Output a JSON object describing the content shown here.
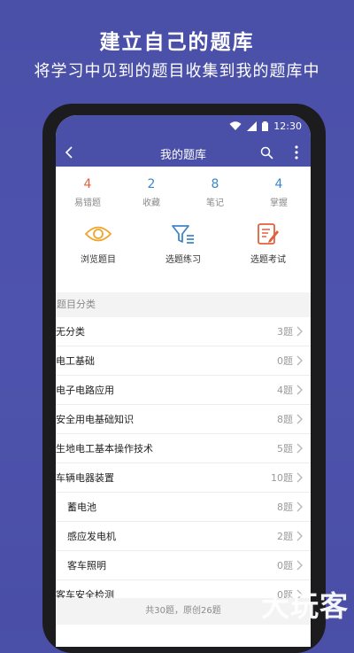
{
  "promo": {
    "title": "建立自己的题库",
    "subtitle": "将学习中见到的题目收集到我的题库中"
  },
  "status_bar": {
    "time": "12:30"
  },
  "app_bar": {
    "title": "我的题库"
  },
  "stats": [
    {
      "value": "4",
      "label": "易错题",
      "color": "#e0603d"
    },
    {
      "value": "2",
      "label": "收藏",
      "color": "#3e86c9"
    },
    {
      "value": "8",
      "label": "笔记",
      "color": "#3e86c9"
    },
    {
      "value": "4",
      "label": "掌握",
      "color": "#3e86c9"
    }
  ],
  "actions": [
    {
      "label": "浏览题目",
      "icon": "eye-icon"
    },
    {
      "label": "选题练习",
      "icon": "filter-icon"
    },
    {
      "label": "选题考试",
      "icon": "exam-edit-icon"
    }
  ],
  "section_header": "题目分类",
  "categories": [
    {
      "name": "无分类",
      "count": "3题"
    },
    {
      "name": "电工基础",
      "count": "0题"
    },
    {
      "name": "电子电路应用",
      "count": "4题"
    },
    {
      "name": "安全用电基础知识",
      "count": "8题"
    },
    {
      "name": "生地电工基本操作技术",
      "count": "5题"
    },
    {
      "name": "车辆电器装置",
      "count": "10题"
    },
    {
      "name": "蓄电池",
      "count": "8题"
    },
    {
      "name": "感应发电机",
      "count": "2题"
    },
    {
      "name": "客车照明",
      "count": "0题"
    },
    {
      "name": "客车安全检测",
      "count": "0题"
    }
  ],
  "footer": "共30题，原创26题",
  "watermark": "大玩客",
  "colors": {
    "brand": "#4a4fa8",
    "accent_orange": "#e0603d",
    "accent_blue": "#3e86c9"
  }
}
